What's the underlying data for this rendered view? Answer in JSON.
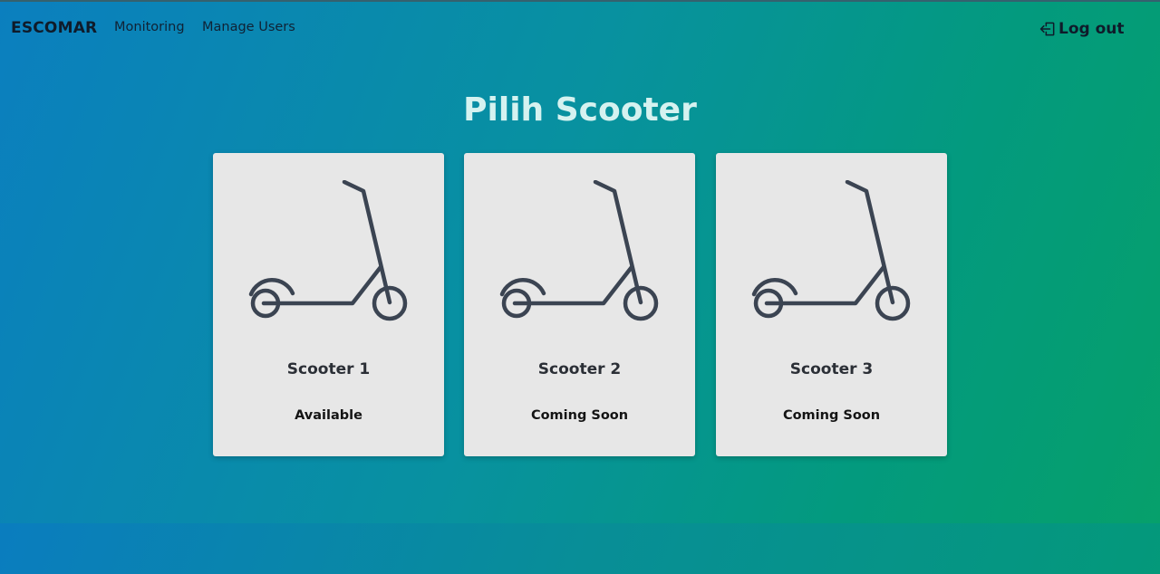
{
  "nav": {
    "brand": "ESCOMAR",
    "links": [
      "Monitoring",
      "Manage Users"
    ],
    "logout_label": "Log out",
    "logout_icon": "logout-icon"
  },
  "page": {
    "title": "Pilih Scooter"
  },
  "scooters": [
    {
      "name": "Scooter 1",
      "status": "Available",
      "icon": "scooter-icon"
    },
    {
      "name": "Scooter 2",
      "status": "Coming Soon",
      "icon": "scooter-icon"
    },
    {
      "name": "Scooter 3",
      "status": "Coming Soon",
      "icon": "scooter-icon"
    }
  ],
  "colors": {
    "icon_stroke": "#3b4452",
    "card_bg": "#e7e7e7",
    "title": "#d5f2f0"
  }
}
